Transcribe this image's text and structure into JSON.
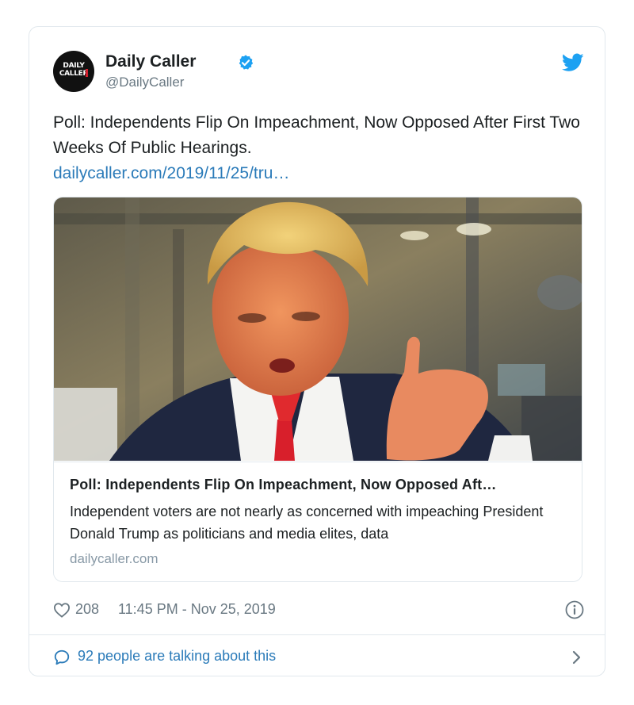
{
  "author": {
    "name": "Daily Caller",
    "handle": "@DailyCaller",
    "avatar_text_line1": "DAILY",
    "avatar_text_line2": "CALLER",
    "verified": true
  },
  "tweet": {
    "text": "Poll: Independents Flip On Impeachment, Now Opposed After First Two Weeks Of Public Hearings.",
    "link_text": "dailycaller.com/2019/11/25/tru…"
  },
  "card": {
    "title": "Poll: Independents Flip On Impeachment, Now Opposed Aft…",
    "description": "Independent voters are not nearly as concerned with impeaching President Donald Trump as politicians and media elites, data",
    "domain": "dailycaller.com"
  },
  "meta": {
    "like_count": "208",
    "timestamp": "11:45 PM - Nov 25, 2019"
  },
  "footer": {
    "talking_text": "92 people are talking about this"
  },
  "icons": {
    "verified": "verified-badge-icon",
    "brand": "twitter-bird-icon",
    "like": "heart-icon",
    "info": "info-icon",
    "replies": "speech-bubble-icon",
    "more": "chevron-right-icon"
  },
  "colors": {
    "link": "#2b7bb9",
    "twitter_blue": "#1da1f2",
    "muted": "#697882",
    "border": "#e1e8ed"
  }
}
